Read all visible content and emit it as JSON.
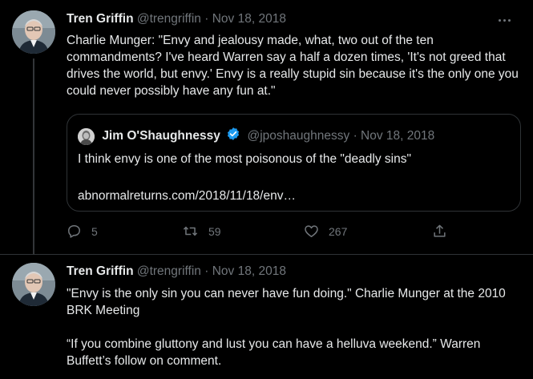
{
  "tweets": [
    {
      "name": "Tren Griffin",
      "handle": "@trengriffin",
      "separator": "·",
      "date": "Nov 18, 2018",
      "text": "Charlie Munger: \"Envy and jealousy made, what, two out of the ten commandments? I've heard Warren say a half a dozen times, 'It's not greed that drives the world, but envy.' Envy is a really stupid sin because it's the only one you could never possibly have any fun at.\"",
      "quote": {
        "name": "Jim O'Shaughnessy",
        "handle": "@jposhaughnessy",
        "separator": "·",
        "date": "Nov 18, 2018",
        "text": "I think envy is one of the most poisonous of the \"deadly sins\"",
        "link": "abnormalreturns.com/2018/11/18/env…"
      },
      "actions": {
        "replies": "5",
        "retweets": "59",
        "likes": "267"
      }
    },
    {
      "name": "Tren Griffin",
      "handle": "@trengriffin",
      "separator": "·",
      "date": "Nov 18, 2018",
      "text_p1": "\"Envy is the only sin you can never have fun doing.\" Charlie Munger at the 2010 BRK Meeting",
      "text_p2": "“If you combine gluttony and lust you can have a helluva weekend.” Warren Buffett’s follow on comment."
    }
  ],
  "icons": {
    "more": "more-horizontal-icon",
    "reply": "reply-icon",
    "retweet": "retweet-icon",
    "like": "heart-icon",
    "share": "share-icon",
    "verified": "verified-badge-icon"
  },
  "colors": {
    "background": "#000000",
    "text": "#e7e9ea",
    "muted": "#71767b",
    "border": "#2f3336",
    "verified": "#1d9bf0"
  }
}
